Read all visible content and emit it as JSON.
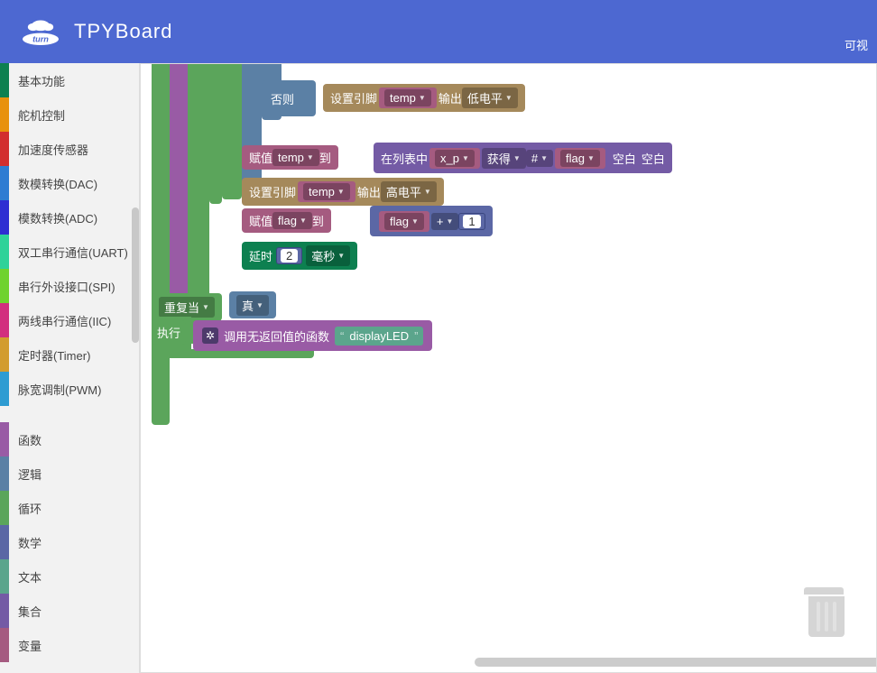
{
  "header": {
    "title": "TPYBoard",
    "right_label": "可视"
  },
  "sidebar": {
    "categories": [
      {
        "label": "基本功能",
        "color": "#0d8050"
      },
      {
        "label": "舵机控制",
        "color": "#e8910c"
      },
      {
        "label": "加速度传感器",
        "color": "#d22e2e"
      },
      {
        "label": "数模转换(DAC)",
        "color": "#2e7cd2"
      },
      {
        "label": "模数转换(ADC)",
        "color": "#2e2ed2"
      },
      {
        "label": "双工串行通信(UART)",
        "color": "#2ed299"
      },
      {
        "label": "串行外设接口(SPI)",
        "color": "#6fd22e"
      },
      {
        "label": "两线串行通信(IIC)",
        "color": "#d22e7e"
      },
      {
        "label": "定时器(Timer)",
        "color": "#d29c2e"
      },
      {
        "label": "脉宽调制(PWM)",
        "color": "#2e9cd2"
      }
    ],
    "generic_categories": [
      {
        "label": "函数",
        "color": "#995ba5"
      },
      {
        "label": "逻辑",
        "color": "#5b80a5"
      },
      {
        "label": "循环",
        "color": "#5ba55b"
      },
      {
        "label": "数学",
        "color": "#5b67a5"
      },
      {
        "label": "文本",
        "color": "#5ba58c"
      },
      {
        "label": "集合",
        "color": "#745ba5"
      },
      {
        "label": "变量",
        "color": "#a55b80"
      }
    ]
  },
  "blocks": {
    "else_label": "否则",
    "set_pin_label": "设置引脚",
    "output_label": "输出",
    "low_level": "低电平",
    "high_level": "高电平",
    "assign_label": "赋值",
    "to_label": "到",
    "in_list_label": "在列表中",
    "get_label": "获得",
    "hash": "#",
    "blank_label": "空白",
    "var_temp": "temp",
    "var_flag": "flag",
    "var_xp": "x_p",
    "plus": "+",
    "num_1": "1",
    "delay_label": "延时",
    "delay_val": "2",
    "delay_unit": "毫秒",
    "repeat_label": "重复当",
    "true_label": "真",
    "exec_label": "执行",
    "call_no_return_label": "调用无返回值的函数",
    "quote_open": "“",
    "quote_close": "”",
    "func_name": "displayLED"
  }
}
